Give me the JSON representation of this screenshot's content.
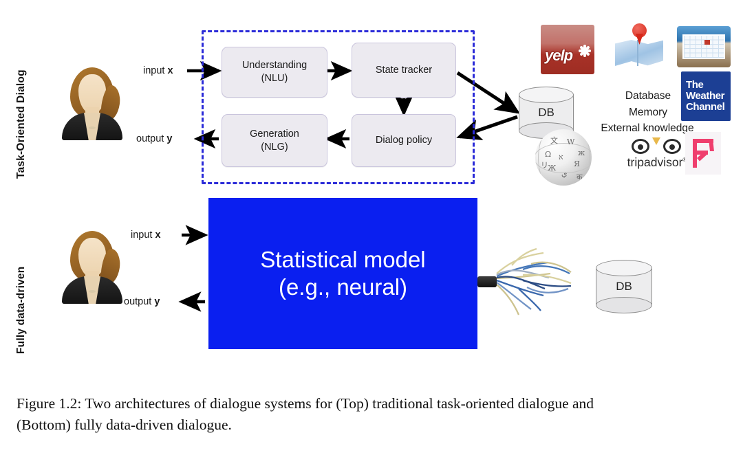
{
  "figure": {
    "rows": [
      {
        "label": "Task-Oriented Dialog"
      },
      {
        "label": "Fully data-driven"
      }
    ],
    "io": {
      "input_prefix": "input ",
      "input_symbol": "x",
      "output_prefix": "output ",
      "output_symbol": "y"
    },
    "pipeline": {
      "boxes": [
        {
          "line1": "Understanding",
          "line2": "(NLU)"
        },
        {
          "line1": "State tracker",
          "line2": ""
        },
        {
          "line1": "Dialog policy",
          "line2": ""
        },
        {
          "line1": "Generation",
          "line2": "(NLG)"
        }
      ],
      "border_color": "#2b2bd8"
    },
    "database": {
      "label": "DB",
      "annotations": [
        "Database",
        "Memory",
        "External knowledge"
      ]
    },
    "statistical_model": {
      "line1": "Statistical model",
      "line2": "(e.g., neural)",
      "background": "#0a1ff0",
      "text_color": "#ffffff"
    },
    "logos": [
      {
        "name": "yelp-logo",
        "text": "yelp",
        "color": "#a83127"
      },
      {
        "name": "map-logo",
        "text": "",
        "color": "#d5281a"
      },
      {
        "name": "calendar-logo",
        "text": "",
        "color": "#2d72ad"
      },
      {
        "name": "weather-channel-logo",
        "line1": "The",
        "line2": "Weather",
        "line3": "Channel",
        "color": "#1c3f94"
      },
      {
        "name": "wikipedia-logo",
        "text": "",
        "color": "#a7a7a7"
      },
      {
        "name": "tripadvisor-logo",
        "text": "tripadvisor",
        "superscript": "®",
        "color": "#2b2b2b"
      },
      {
        "name": "foursquare-logo",
        "text": "",
        "color": "#ef3f6e"
      }
    ],
    "avatar": {
      "name": "user-avatar"
    }
  },
  "caption": {
    "line1": "Figure 1.2:  Two architectures of dialogue systems for (Top) traditional task-oriented dialogue and",
    "line2": "(Bottom) fully data-driven dialogue."
  }
}
